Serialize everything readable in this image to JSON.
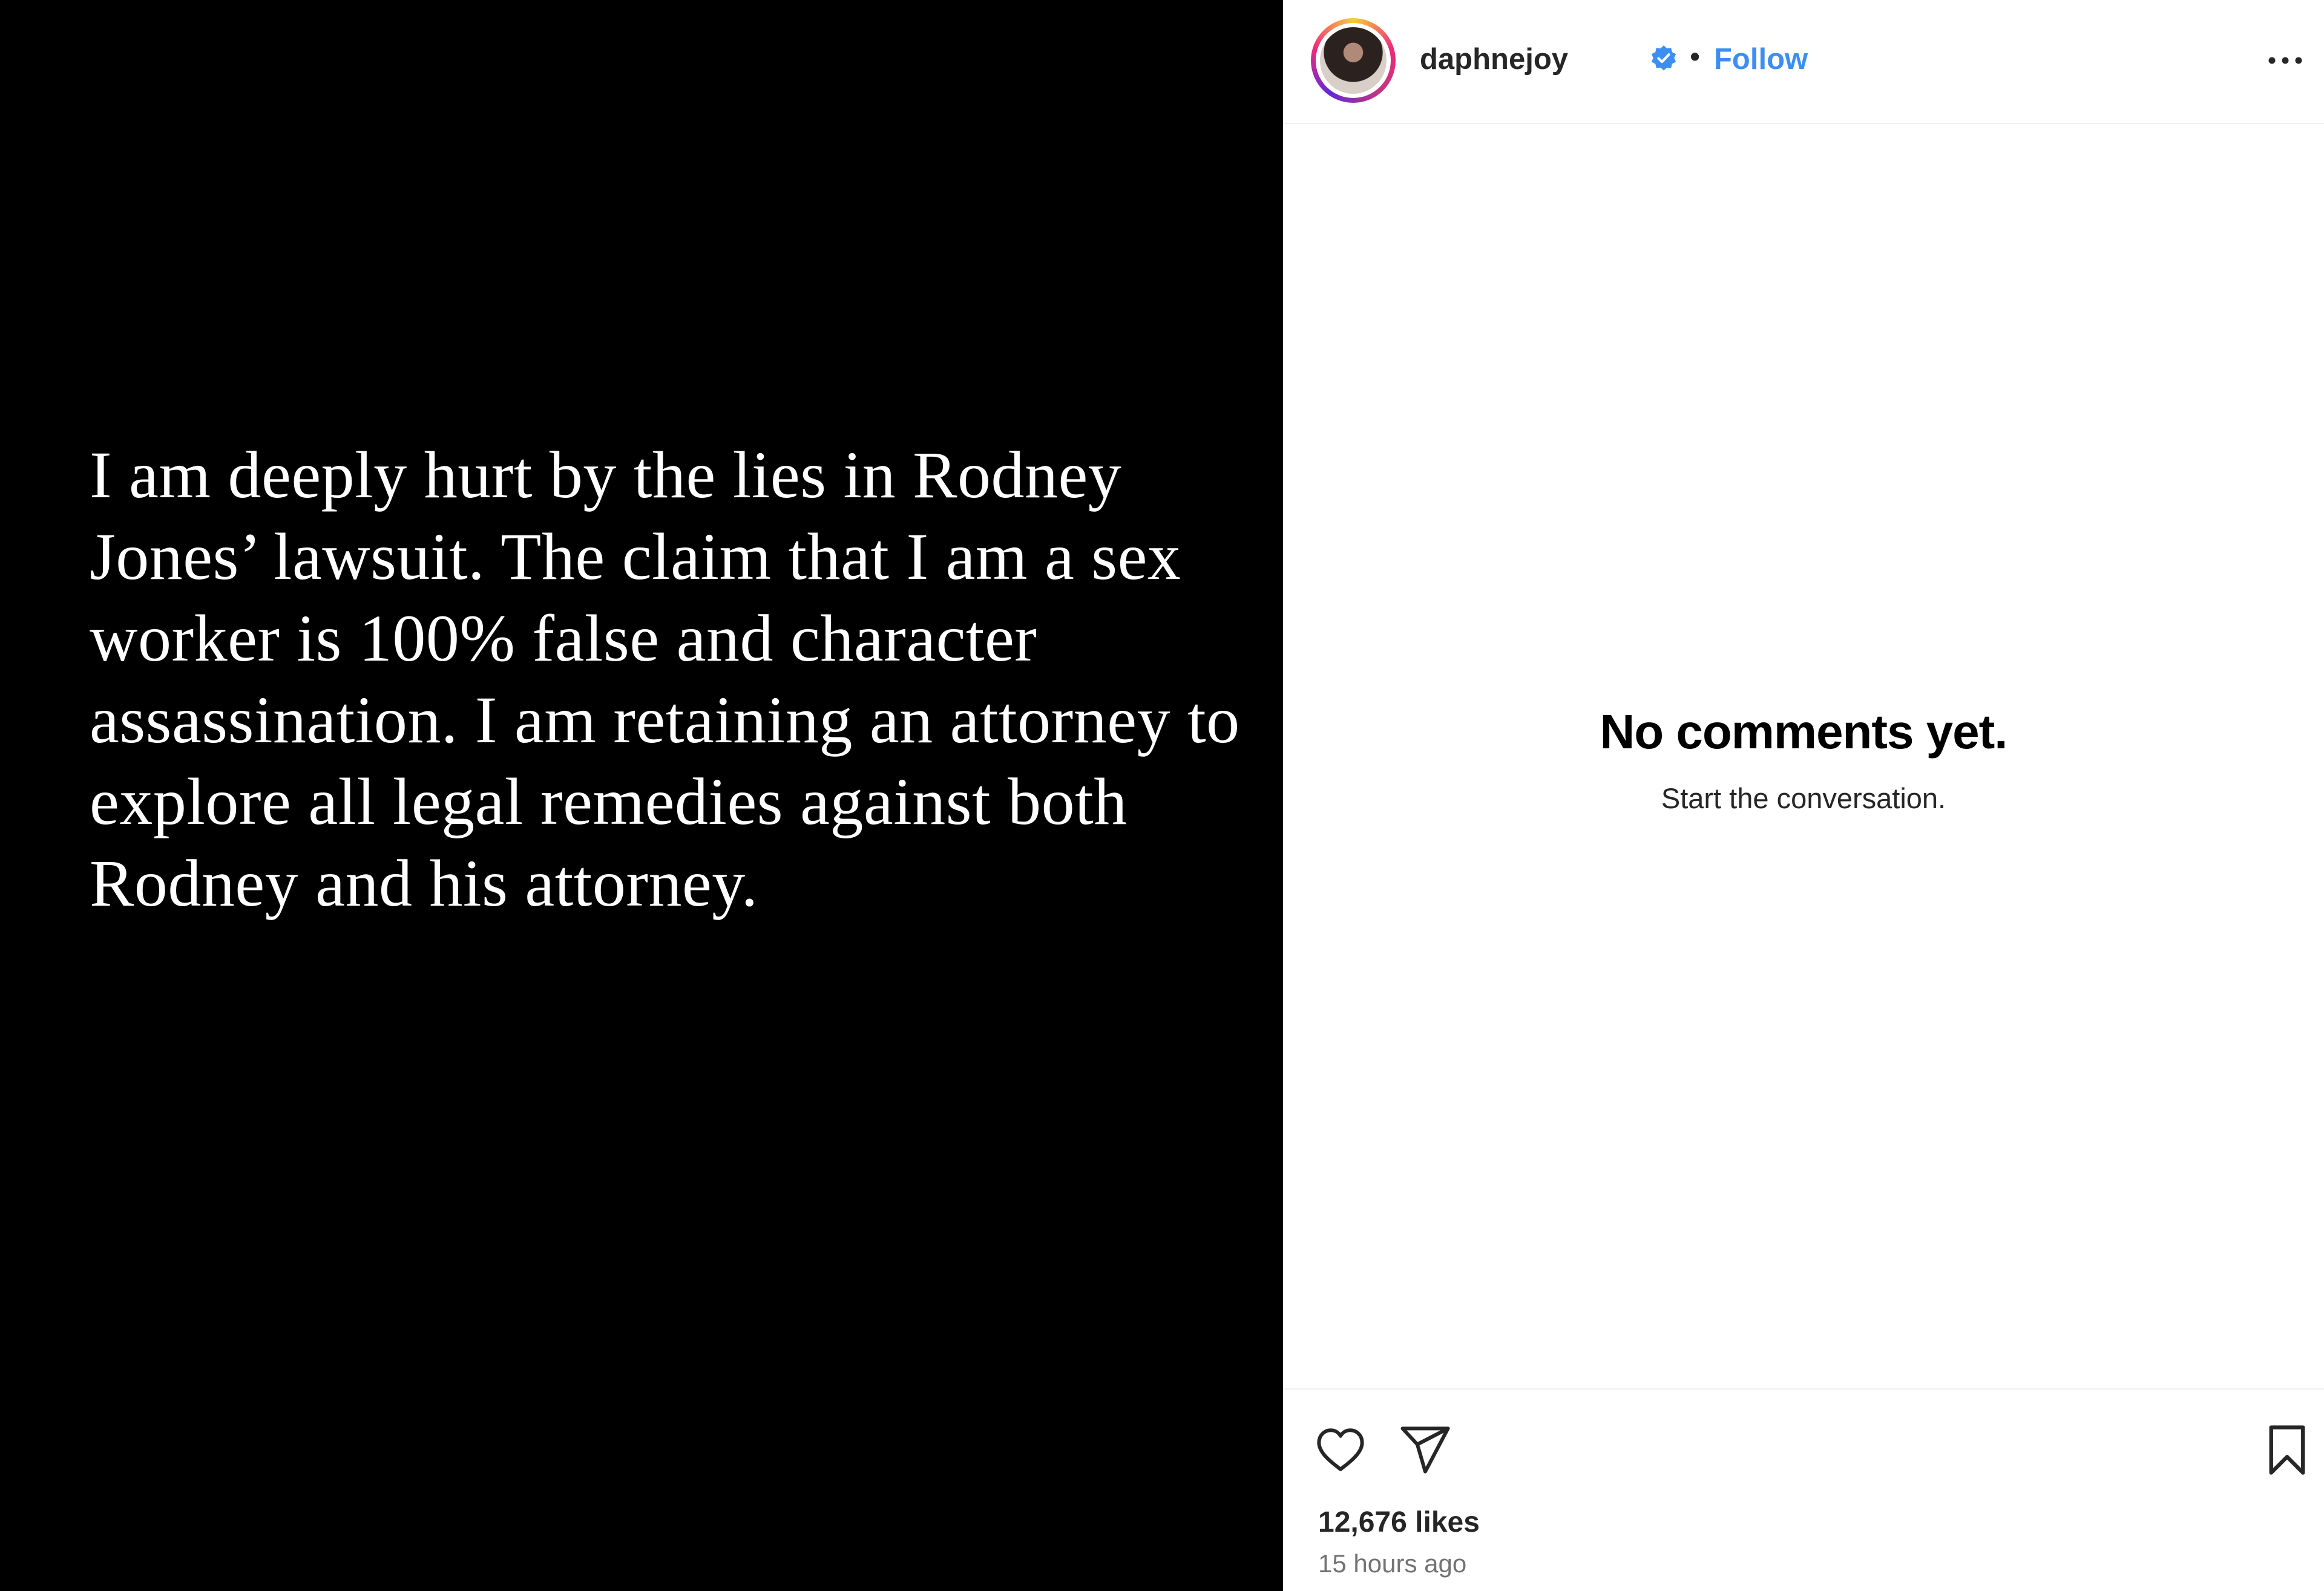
{
  "post": {
    "text": "I am deeply hurt by the lies in Rodney Jones’ lawsuit. The claim that I am a sex worker is 100% false and character assassination. I am retaining an attorney to explore all legal remedies against both Rodney and his attorney."
  },
  "header": {
    "username": "daphnejoy",
    "separator": "•",
    "follow_label": "Follow",
    "verified_icon": "verified-badge-icon",
    "more_icon": "more-options-icon"
  },
  "comments": {
    "empty_title": "No comments yet.",
    "empty_subtitle": "Start the conversation."
  },
  "actions": {
    "like_icon": "heart-icon",
    "share_icon": "paper-plane-icon",
    "save_icon": "bookmark-icon"
  },
  "stats": {
    "likes": "12,676 likes",
    "posted": "15 hours ago"
  },
  "colors": {
    "accent": "#3c8ff0",
    "text": "#262626",
    "muted": "#737373",
    "media_bg": "#000000"
  }
}
